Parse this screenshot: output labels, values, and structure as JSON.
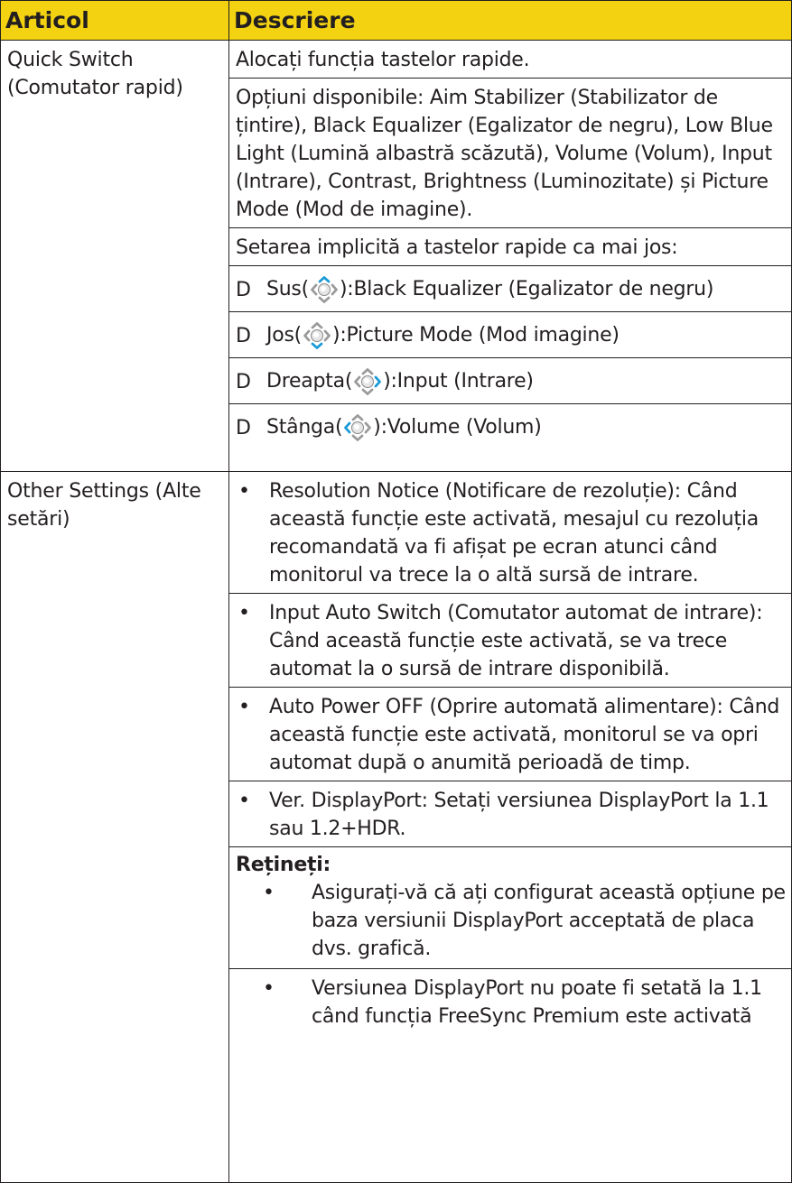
{
  "header": {
    "col1": "Articol",
    "col2": "Descriere"
  },
  "quick_switch": {
    "item": "Quick Switch (Comutator rapid)",
    "line1": "Alocați funcția tastelor rapide.",
    "line2": "Opțiuni disponibile: Aim Stabilizer (Stabilizator de țintire), Black Equalizer (Egalizator de negru), Low Blue Light (Lumină albastră scăzută), Volume (Volum), Input (Intrare), Contrast, Brightness (Luminozitate) și Picture Mode (Mod de imagine).",
    "line3": "Setarea implicită a tastelor rapide ca mai jos:",
    "bullet_glyph": "D",
    "directions": [
      {
        "name": "Sus(",
        "value": "):Black Equalizer (Egalizator de negru)",
        "highlight": "up"
      },
      {
        "name": "Jos(",
        "value": "):Picture Mode (Mod imagine)",
        "highlight": "down"
      },
      {
        "name": "Dreapta(",
        "value": "):Input (Intrare)",
        "highlight": "right"
      },
      {
        "name": "Stânga(",
        "value": "):Volume (Volum)",
        "highlight": "left"
      }
    ]
  },
  "other_settings": {
    "item": "Other Settings (Alte setări)",
    "bullets": [
      "Resolution Notice (Notificare de rezoluție): Când această funcție este activată, mesajul cu rezoluția recomandată va fi afișat pe ecran atunci când monitorul va trece la o altă sursă de intrare.",
      "Input Auto Switch (Comutator automat de intrare): Când această funcție este activată, se va trece automat la o sursă de intrare disponibilă.",
      "Auto Power OFF (Oprire automată alimentare): Când această funcție este activată, monitorul se va opri automat după o anumită perioadă de timp.",
      "Ver. DisplayPort: Setați versiunea DisplayPort la 1.1 sau 1.2+HDR."
    ],
    "note_title": "Rețineți:",
    "notes": [
      "Asigurați-vă că ați configurat această opțiune pe baza versiunii DisplayPort acceptată de placa dvs. grafică.",
      "Versiunea DisplayPort nu poate fi setată la 1.1 când funcția FreeSync Premium este activată"
    ]
  },
  "colors": {
    "header_bg": "#f2d211",
    "arrow_active": "#1a9ad6",
    "arrow_idle": "#9a9a9a"
  }
}
